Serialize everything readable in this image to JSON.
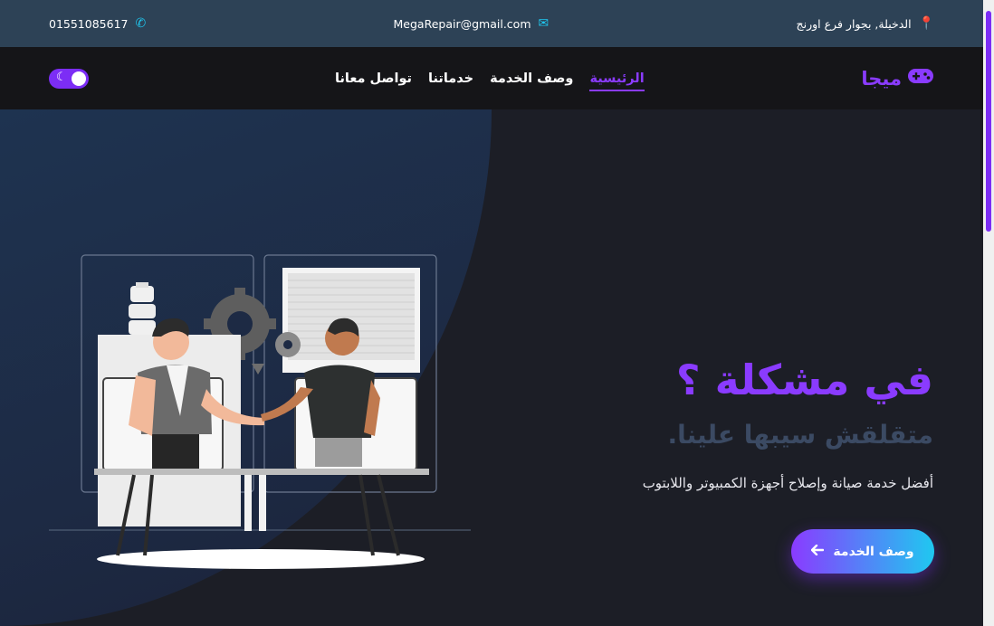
{
  "topbar": {
    "phone": "01551085617",
    "email": "MegaRepair@gmail.com",
    "address": "الدخيلة, بجوار فرع اورنج",
    "phone_icon": "phone-icon",
    "email_icon": "envelope-icon",
    "address_icon": "map-pin-icon"
  },
  "navbar": {
    "logo_text": "ميجا",
    "logo_icon": "gamepad-icon",
    "links": [
      {
        "label": "الرئيسية",
        "active": true
      },
      {
        "label": "وصف الخدمة",
        "active": false
      },
      {
        "label": "خدماتنا",
        "active": false
      },
      {
        "label": "تواصل معانا",
        "active": false
      }
    ],
    "theme_toggle_icon": "moon-icon"
  },
  "hero": {
    "title": "في مشكلة ؟",
    "subtitle": "متقلقش سيبها علينا.",
    "description": "أفضل خدمة صيانة وإصلاح أجهزة الكمبيوتر واللابتوب",
    "cta_label": "وصف الخدمة",
    "cta_icon": "arrow-left-icon"
  },
  "colors": {
    "accent": "#8a3bff",
    "cyan": "#1fc8f0",
    "topbar_bg": "#2d4256",
    "navbar_bg": "#151518",
    "hero_bg": "#1c1e26"
  }
}
